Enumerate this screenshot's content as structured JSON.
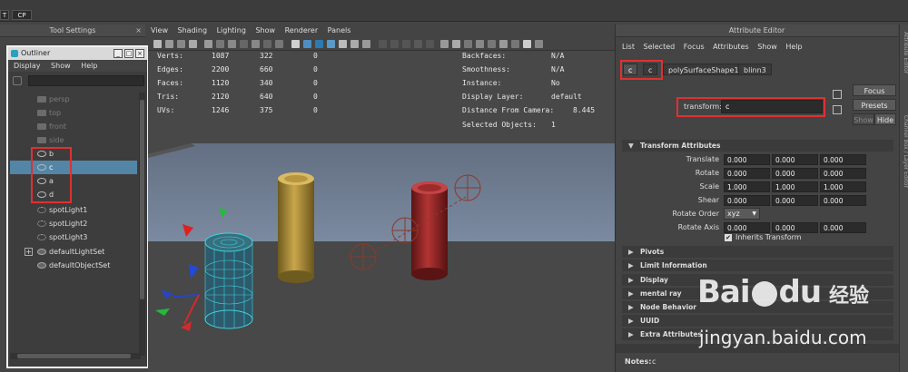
{
  "topbar": {
    "btn1": "T",
    "btn2": "CP"
  },
  "tool_settings": {
    "title": "Tool Settings",
    "close": "×"
  },
  "outliner": {
    "title": "Outliner",
    "menu": [
      "Display",
      "Show",
      "Help"
    ],
    "items": [
      {
        "label": "persp",
        "kind": "camera",
        "dim": true
      },
      {
        "label": "top",
        "kind": "camera",
        "dim": true
      },
      {
        "label": "front",
        "kind": "camera",
        "dim": true
      },
      {
        "label": "side",
        "kind": "camera",
        "dim": true
      },
      {
        "label": "b",
        "kind": "transform"
      },
      {
        "label": "c",
        "kind": "transform",
        "selected": true
      },
      {
        "label": "a",
        "kind": "transform"
      },
      {
        "label": "d",
        "kind": "transform"
      },
      {
        "label": "spotLight1",
        "kind": "light"
      },
      {
        "label": "spotLight2",
        "kind": "light"
      },
      {
        "label": "spotLight3",
        "kind": "light"
      },
      {
        "label": "defaultLightSet",
        "kind": "set",
        "expandable": true
      },
      {
        "label": "defaultObjectSet",
        "kind": "set"
      }
    ]
  },
  "viewport": {
    "menu": [
      "View",
      "Shading",
      "Lighting",
      "Show",
      "Renderer",
      "Panels"
    ],
    "hud_left": [
      {
        "label": "Verts:",
        "v1": "1087",
        "v2": "322",
        "v3": "0"
      },
      {
        "label": "Edges:",
        "v1": "2200",
        "v2": "660",
        "v3": "0"
      },
      {
        "label": "Faces:",
        "v1": "1120",
        "v2": "340",
        "v3": "0"
      },
      {
        "label": "Tris:",
        "v1": "2120",
        "v2": "640",
        "v3": "0"
      },
      {
        "label": "UVs:",
        "v1": "1246",
        "v2": "375",
        "v3": "0"
      }
    ],
    "hud_right": [
      {
        "label": "Backfaces:",
        "value": "N/A"
      },
      {
        "label": "Smoothness:",
        "value": "N/A"
      },
      {
        "label": "Instance:",
        "value": "No"
      },
      {
        "label": "Display Layer:",
        "value": "default"
      },
      {
        "label": "Distance From Camera:",
        "value": "8.445"
      },
      {
        "label": "Selected Objects:",
        "value": "1"
      }
    ]
  },
  "attribute_editor": {
    "title": "Attribute Editor",
    "menu": [
      "List",
      "Selected",
      "Focus",
      "Attributes",
      "Show",
      "Help"
    ],
    "tabs": [
      "c",
      "c",
      "polySurfaceShape1",
      "blinn3"
    ],
    "buttons": {
      "focus": "Focus",
      "presets": "Presets",
      "show": "Show",
      "hide": "Hide"
    },
    "transform_label": "transform:",
    "transform_value": "c",
    "sections": {
      "transform": "Transform Attributes",
      "others": [
        "Pivots",
        "Limit Information",
        "Display",
        "mental ray",
        "Node Behavior",
        "UUID",
        "Extra Attributes"
      ]
    },
    "rows": [
      {
        "label": "Translate",
        "values": [
          "0.000",
          "0.000",
          "0.000"
        ]
      },
      {
        "label": "Rotate",
        "values": [
          "0.000",
          "0.000",
          "0.000"
        ]
      },
      {
        "label": "Scale",
        "values": [
          "1.000",
          "1.000",
          "1.000"
        ]
      },
      {
        "label": "Shear",
        "values": [
          "0.000",
          "0.000",
          "0.000"
        ]
      }
    ],
    "rotate_order_label": "Rotate Order",
    "rotate_order_value": "xyz",
    "rotate_axis_label": "Rotate Axis",
    "rotate_axis_values": [
      "0.000",
      "0.000",
      "0.000"
    ],
    "inherits_label": "Inherits Transform",
    "notes_label": "Notes:",
    "notes_value": "c"
  },
  "channel_box_tab": "Channel Box / Layer Editor",
  "attr_editor_tab": "Attribute Editor",
  "watermark": {
    "brand": "Bai",
    "brand2": "du",
    "cn": "经验",
    "url": "jingyan.baidu.com"
  },
  "colors": {
    "highlight": "#e03030",
    "selection": "#5285a6"
  }
}
